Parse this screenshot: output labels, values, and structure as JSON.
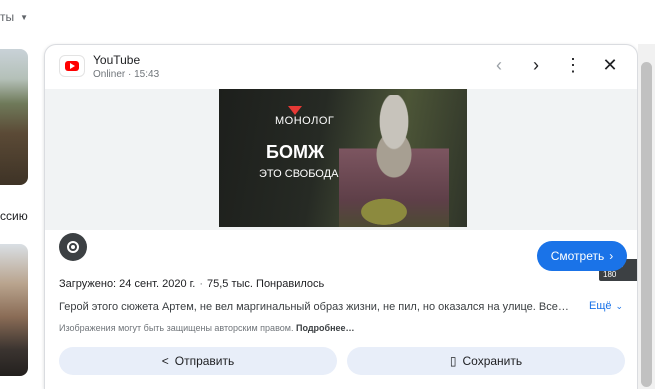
{
  "left": {
    "filter_label": "ты",
    "caption": "ссию"
  },
  "header": {
    "site": "YouTube",
    "meta": "Onliner · 15:43"
  },
  "image": {
    "channel_logo": "МОНОЛОГ",
    "title": "БОМЖ",
    "subtitle": "ЭТО СВОБОДА",
    "dimensions": "320 × 180"
  },
  "actions": {
    "watch_label": "Смотреть",
    "share_label": "Отправить",
    "save_label": "Сохранить"
  },
  "info": {
    "uploaded": "Загружено: 24 сент. 2020 г.",
    "likes": "75,5 тыс. Понравилось",
    "description": "Герой этого сюжета Артем, не вел маргинальный образ жизни, не пил, но оказался на улице. Все…",
    "more_label": "Ещё",
    "copyright": "Изображения могут быть защищены авторским правом.",
    "learn_more": "Подробнее…"
  },
  "colors": {
    "accent": "#1a73e8",
    "button_bg": "#e8eef9",
    "youtube_red": "#ff0000"
  },
  "icons": [
    "youtube-logo-icon",
    "chevron-left-icon",
    "chevron-right-icon",
    "more-vert-icon",
    "close-icon",
    "lens-icon",
    "chevron-right-small-icon",
    "expand-more-icon",
    "share-icon",
    "bookmark-icon"
  ]
}
